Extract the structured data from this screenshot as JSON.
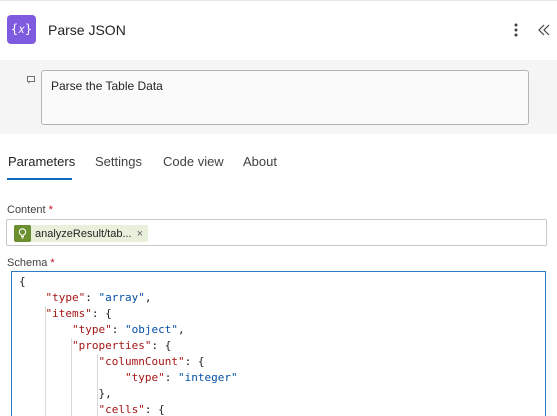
{
  "header": {
    "icon_glyph": "{𝑥}",
    "title": "Parse JSON"
  },
  "description": {
    "text": "Parse the Table Data"
  },
  "tabs": [
    {
      "label": "Parameters",
      "active": true
    },
    {
      "label": "Settings",
      "active": false
    },
    {
      "label": "Code view",
      "active": false
    },
    {
      "label": "About",
      "active": false
    }
  ],
  "content_field": {
    "label": "Content",
    "required_mark": "*",
    "token_text": "analyzeResult/tab...",
    "token_remove": "×"
  },
  "schema_field": {
    "label": "Schema",
    "required_mark": "*",
    "lines": [
      "{",
      "    \"type\": \"array\",",
      "    \"items\": {",
      "        \"type\": \"object\",",
      "        \"properties\": {",
      "            \"columnCount\": {",
      "                \"type\": \"integer\"",
      "            },",
      "            \"cells\": {"
    ]
  },
  "colors": {
    "accent": "#0f6cbd",
    "action_icon": "#7f5be0",
    "token_icon": "#6b8f2f",
    "required": "#c50f1f"
  }
}
